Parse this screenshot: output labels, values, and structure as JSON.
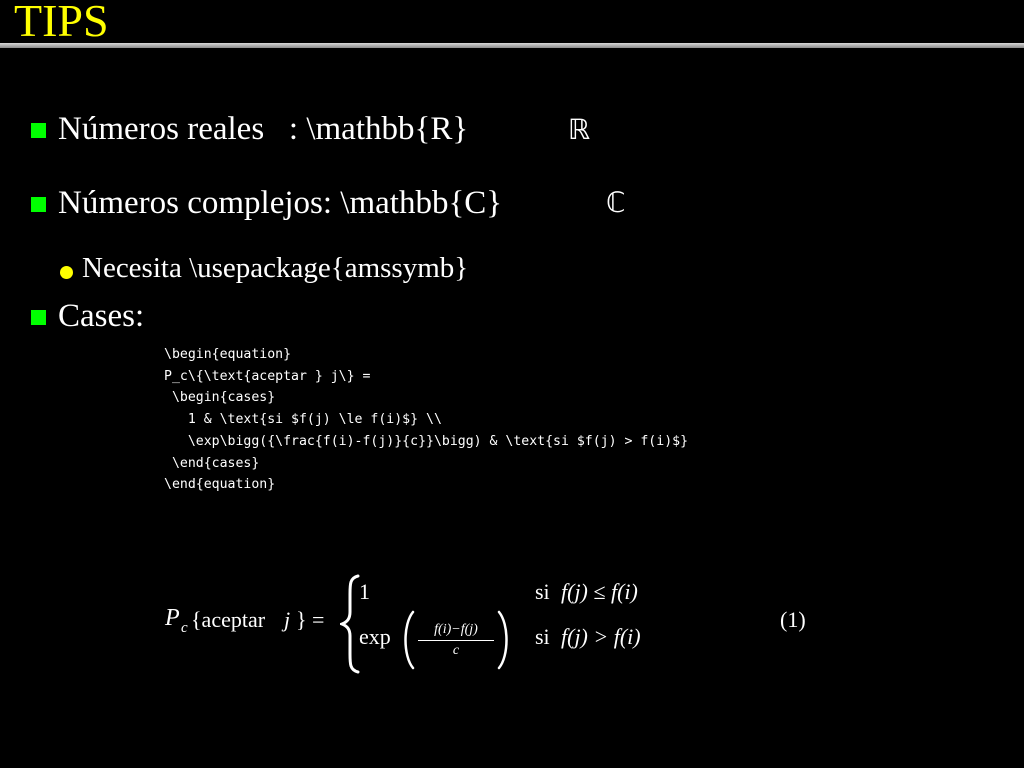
{
  "slide": {
    "title": "TIPS"
  },
  "bullets": [
    {
      "text": "Números reales   : \\mathbb{R}",
      "symbol": "ℝ"
    },
    {
      "text": "Números complejos: \\mathbb{C}",
      "symbol": "ℂ"
    }
  ],
  "subbullet": {
    "text": "Necesita \\usepackage{amssymb}"
  },
  "cases_bullet": {
    "text": "Cases:"
  },
  "code": "\\begin{equation}\nP_c\\{\\text{aceptar } j\\} =\n \\begin{cases}\n   1 & \\text{si $f(j) \\le f(i)$} \\\\\n   \\exp\\bigg({\\frac{f(i)-f(j)}{c}}\\bigg) & \\text{si $f(j) > f(i)$}\n \\end{cases}\n\\end{equation}",
  "equation": {
    "lhs_P": "P",
    "lhs_sub": "c",
    "lhs_open": "{aceptar ",
    "lhs_j": "j",
    "lhs_close": "} =",
    "case1_value": "1",
    "case1_cond_si": "si ",
    "case1_cond_expr": "f(j) ≤ f(i)",
    "case2_exp": "exp",
    "case2_frac_num": "f(i)−f(j)",
    "case2_frac_den": "c",
    "case2_cond_si": "si ",
    "case2_cond_expr": "f(j) > f(i)",
    "number": "(1)"
  },
  "colors": {
    "background": "#000000",
    "title": "#ffff00",
    "bullet": "#00ff00",
    "subbullet": "#ffff00",
    "text": "#ffffff"
  }
}
